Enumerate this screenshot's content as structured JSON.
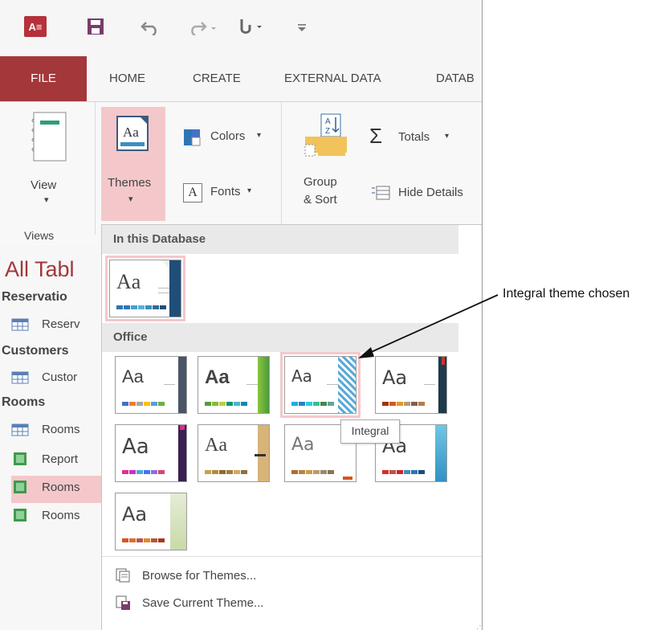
{
  "quick_access": {
    "app_icon": "access-logo-icon",
    "app_icon_text": "A",
    "save": "save-icon",
    "undo": "undo-icon",
    "redo": "redo-icon",
    "touch": "touch-mode-icon",
    "customize": "customize-toolbar-icon"
  },
  "tabs": [
    "FILE",
    "HOME",
    "CREATE",
    "EXTERNAL DATA",
    "DATAB"
  ],
  "ribbon": {
    "view_label": "View",
    "themes_label": "Themes",
    "colors_label": "Colors",
    "fonts_label": "Fonts",
    "group_sort_line1": "Group",
    "group_sort_line2": "& Sort",
    "totals_label": "Totals",
    "hide_details_label": "Hide Details",
    "views_group_label": "Views"
  },
  "nav": {
    "title": "All Tabl",
    "groups": [
      {
        "name": "Reservatio",
        "items": [
          {
            "label": "Reserv",
            "icon": "table-icon"
          }
        ]
      },
      {
        "name": "Customers",
        "items": [
          {
            "label": "Custor",
            "icon": "table-icon"
          }
        ]
      },
      {
        "name": "Rooms",
        "items": [
          {
            "label": "Rooms",
            "icon": "table-icon"
          },
          {
            "label": "Report",
            "icon": "report-icon"
          },
          {
            "label": "Rooms",
            "icon": "report-icon",
            "selected": true
          },
          {
            "label": "Rooms",
            "icon": "report-icon"
          }
        ]
      }
    ]
  },
  "gallery": {
    "section_database": "In this Database",
    "section_office": "Office",
    "thumb_text": "Aa",
    "hovered_theme": "Integral",
    "browse_label": "Browse for Themes...",
    "save_label": "Save Current Theme..."
  },
  "annotation": "Integral theme chosen",
  "colors": {
    "file_tab": "#a4373a",
    "highlight": "#f4c8cb",
    "nav_title": "#a4373a"
  }
}
